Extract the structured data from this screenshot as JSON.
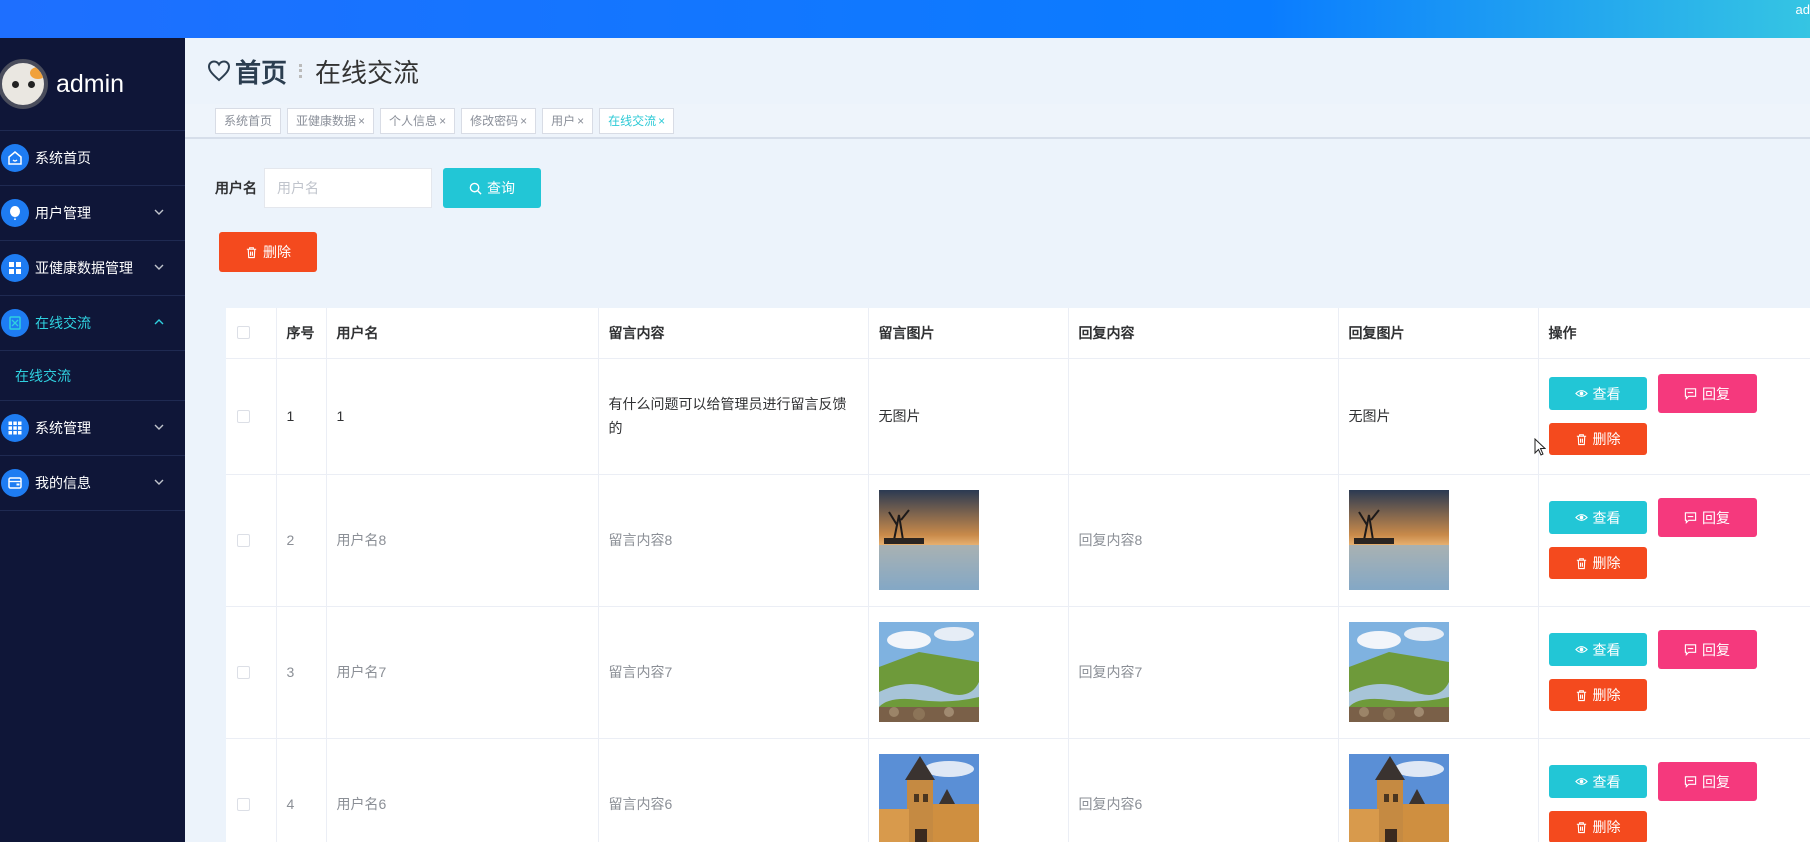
{
  "topbar": {
    "right_text": "ad"
  },
  "sidebar": {
    "username": "admin",
    "menu": [
      {
        "label": "系统首页",
        "icon": "home-icon",
        "has_chevron": false
      },
      {
        "label": "用户管理",
        "icon": "balloon-icon",
        "has_chevron": true
      },
      {
        "label": "亚健康数据管理",
        "icon": "grid-icon",
        "has_chevron": true
      },
      {
        "label": "在线交流",
        "icon": "chat-icon",
        "has_chevron": true,
        "expanded": true
      },
      {
        "label": "系统管理",
        "icon": "apps-icon",
        "has_chevron": true
      },
      {
        "label": "我的信息",
        "icon": "wallet-icon",
        "has_chevron": true
      }
    ],
    "submenu": {
      "label": "在线交流"
    }
  },
  "header": {
    "home": "首页",
    "current": "在线交流"
  },
  "tags": [
    {
      "label": "系统首页",
      "closable": false
    },
    {
      "label": "亚健康数据",
      "closable": true
    },
    {
      "label": "个人信息",
      "closable": true
    },
    {
      "label": "修改密码",
      "closable": true
    },
    {
      "label": "用户",
      "closable": true
    },
    {
      "label": "在线交流",
      "closable": true,
      "active": true
    }
  ],
  "search": {
    "label": "用户名",
    "placeholder": "用户名",
    "button": "查询"
  },
  "toolbar": {
    "delete_label": "删除"
  },
  "table": {
    "columns": [
      "序号",
      "用户名",
      "留言内容",
      "留言图片",
      "回复内容",
      "回复图片",
      "操作"
    ],
    "rows": [
      {
        "index": "1",
        "username": "1",
        "message": "有什么问题可以给管理员进行留言反馈的",
        "message_image": "无图片",
        "reply": "",
        "reply_image": "无图片"
      },
      {
        "index": "2",
        "username": "用户名8",
        "message": "留言内容8",
        "message_image": "lake-sunset-photo",
        "reply": "回复内容8",
        "reply_image": "lake-sunset-photo"
      },
      {
        "index": "3",
        "username": "用户名7",
        "message": "留言内容7",
        "message_image": "meadow-stream-photo",
        "reply": "回复内容7",
        "reply_image": "meadow-stream-photo"
      },
      {
        "index": "4",
        "username": "用户名6",
        "message": "留言内容6",
        "message_image": "prague-tower-photo",
        "reply": "回复内容6",
        "reply_image": "prague-tower-photo"
      }
    ],
    "actions": {
      "view": "查看",
      "reply": "回复",
      "delete": "删除"
    }
  },
  "colors": {
    "sidebar_bg": "#0f1638",
    "accent_cyan": "#22c6d6",
    "danger": "#f44a1e",
    "reply_pink": "#f5397d",
    "menu_icon_blue": "#1e7cf2"
  }
}
